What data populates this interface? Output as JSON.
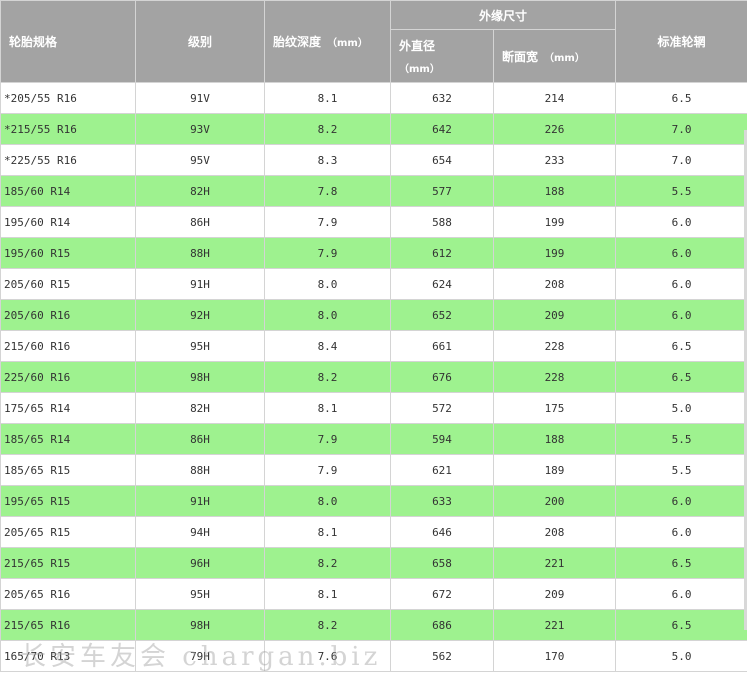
{
  "header": {
    "spec": "轮胎规格",
    "grade": "级别",
    "tread_depth": "胎纹深度",
    "tread_unit": "（mm）",
    "outer_size": "外缘尺寸",
    "outer_diameter": "外直径",
    "outer_diameter_unit": "（mm）",
    "section_width": "断面宽",
    "section_width_unit": "（mm）",
    "rim": "标准轮辋"
  },
  "rows": [
    {
      "spec": "*205/55 R16",
      "grade": "91V",
      "depth": "8.1",
      "diameter": "632",
      "width": "214",
      "rim": "6.5"
    },
    {
      "spec": "*215/55 R16",
      "grade": "93V",
      "depth": "8.2",
      "diameter": "642",
      "width": "226",
      "rim": "7.0"
    },
    {
      "spec": "*225/55 R16",
      "grade": "95V",
      "depth": "8.3",
      "diameter": "654",
      "width": "233",
      "rim": "7.0"
    },
    {
      "spec": "185/60 R14",
      "grade": "82H",
      "depth": "7.8",
      "diameter": "577",
      "width": "188",
      "rim": "5.5"
    },
    {
      "spec": "195/60 R14",
      "grade": "86H",
      "depth": "7.9",
      "diameter": "588",
      "width": "199",
      "rim": "6.0"
    },
    {
      "spec": "195/60 R15",
      "grade": "88H",
      "depth": "7.9",
      "diameter": "612",
      "width": "199",
      "rim": "6.0"
    },
    {
      "spec": "205/60 R15",
      "grade": "91H",
      "depth": "8.0",
      "diameter": "624",
      "width": "208",
      "rim": "6.0"
    },
    {
      "spec": "205/60 R16",
      "grade": "92H",
      "depth": "8.0",
      "diameter": "652",
      "width": "209",
      "rim": "6.0"
    },
    {
      "spec": "215/60 R16",
      "grade": "95H",
      "depth": "8.4",
      "diameter": "661",
      "width": "228",
      "rim": "6.5"
    },
    {
      "spec": "225/60 R16",
      "grade": "98H",
      "depth": "8.2",
      "diameter": "676",
      "width": "228",
      "rim": "6.5"
    },
    {
      "spec": "175/65 R14",
      "grade": "82H",
      "depth": "8.1",
      "diameter": "572",
      "width": "175",
      "rim": "5.0"
    },
    {
      "spec": "185/65 R14",
      "grade": "86H",
      "depth": "7.9",
      "diameter": "594",
      "width": "188",
      "rim": "5.5"
    },
    {
      "spec": "185/65 R15",
      "grade": "88H",
      "depth": "7.9",
      "diameter": "621",
      "width": "189",
      "rim": "5.5"
    },
    {
      "spec": "195/65 R15",
      "grade": "91H",
      "depth": "8.0",
      "diameter": "633",
      "width": "200",
      "rim": "6.0"
    },
    {
      "spec": "205/65 R15",
      "grade": "94H",
      "depth": "8.1",
      "diameter": "646",
      "width": "208",
      "rim": "6.0"
    },
    {
      "spec": "215/65 R15",
      "grade": "96H",
      "depth": "8.2",
      "diameter": "658",
      "width": "221",
      "rim": "6.5"
    },
    {
      "spec": "205/65 R16",
      "grade": "95H",
      "depth": "8.1",
      "diameter": "672",
      "width": "209",
      "rim": "6.0"
    },
    {
      "spec": "215/65 R16",
      "grade": "98H",
      "depth": "8.2",
      "diameter": "686",
      "width": "221",
      "rim": "6.5"
    },
    {
      "spec": "165/70 R13",
      "grade": "79H",
      "depth": "7.6",
      "diameter": "562",
      "width": "170",
      "rim": "5.0"
    }
  ],
  "watermark": "长安车友会 chargan.biz",
  "colors": {
    "header_bg": "#a3a3a3",
    "stripe": "#9ef28f"
  }
}
